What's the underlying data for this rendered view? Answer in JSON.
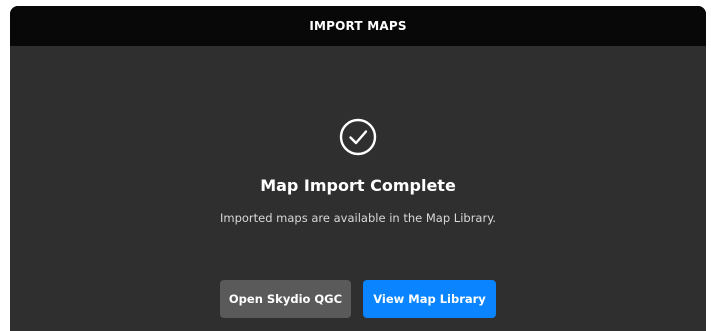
{
  "dialog": {
    "title": "IMPORT MAPS",
    "status_icon": "check-circle-icon",
    "heading": "Map Import Complete",
    "message": "Imported maps are available in the Map Library.",
    "buttons": {
      "secondary_label": "Open Skydio QGC",
      "primary_label": "View Map Library"
    }
  },
  "colors": {
    "titlebar_bg": "#080808",
    "body_bg": "#2f2f2f",
    "secondary_button": "#5a5a5a",
    "primary_button": "#0a84ff"
  }
}
